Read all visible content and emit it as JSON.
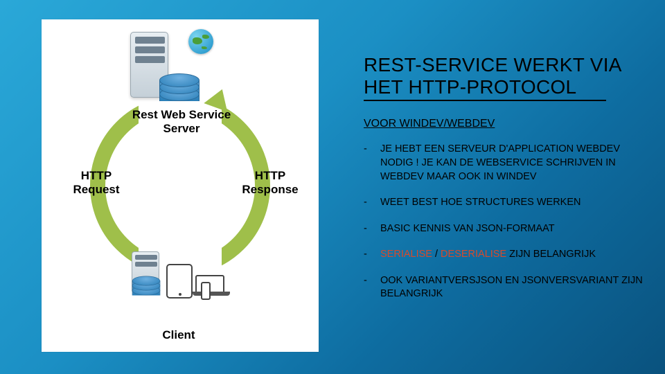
{
  "title": "REST-SERVICE WERKT VIA HET HTTP-PROTOCOL",
  "subtitle": "VOOR WINDEV/WEBDEV",
  "bullets": [
    {
      "text": "JE HEBT EEN SERVEUR D'APPLICATION WEBDEV NODIG ! JE KAN DE WEBSERVICE SCHRIJVEN IN WEBDEV MAAR OOK IN WINDEV"
    },
    {
      "text": "WEET BEST HOE STRUCTURES WERKEN"
    },
    {
      "text": "BASIC KENNIS VAN JSON-FORMAAT"
    },
    {
      "pre": "",
      "em1": "SERIALISE",
      "mid": " / ",
      "em2": "DESERIALISE",
      "post": " ZIJN BELANGRIJK"
    },
    {
      "text": "OOK VARIANTVERSJSON EN JSONVERSVARIANT ZIJN BELANGRIJK"
    }
  ],
  "diagram": {
    "server_label_line1": "Rest Web Service",
    "server_label_line2": "Server",
    "request_label_line1": "HTTP",
    "request_label_line2": "Request",
    "response_label_line1": "HTTP",
    "response_label_line2": "Response",
    "client_label": "Client"
  },
  "bullet_dash": "-"
}
